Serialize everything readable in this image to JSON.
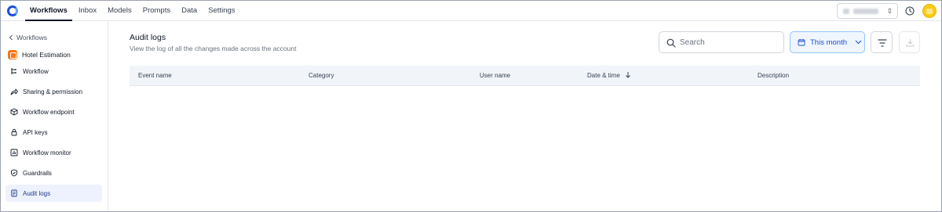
{
  "nav": {
    "tabs": [
      {
        "label": "Workflows",
        "active": true
      },
      {
        "label": "Inbox"
      },
      {
        "label": "Models"
      },
      {
        "label": "Prompts"
      },
      {
        "label": "Data"
      },
      {
        "label": "Settings"
      }
    ]
  },
  "sidebar": {
    "back_label": "Workflows",
    "project_name": "Hotel Estimation",
    "items": [
      {
        "label": "Workflow",
        "icon": "workflow-icon"
      },
      {
        "label": "Sharing & permission",
        "icon": "share-icon"
      },
      {
        "label": "Workflow endpoint",
        "icon": "cube-icon"
      },
      {
        "label": "API keys",
        "icon": "lock-icon"
      },
      {
        "label": "Workflow monitor",
        "icon": "monitor-chart-icon"
      },
      {
        "label": "Guardrails",
        "icon": "shield-icon"
      },
      {
        "label": "Audit logs",
        "icon": "document-icon",
        "active": true
      }
    ]
  },
  "page": {
    "title": "Audit logs",
    "subtitle": "View the log of all the changes made across the account"
  },
  "search": {
    "placeholder": "Search"
  },
  "date_filter": {
    "label": "This month"
  },
  "table": {
    "columns": [
      "Event name",
      "Category",
      "User name",
      "Date & time",
      "Description"
    ],
    "sorted_column": "Date & time",
    "sort_direction": "descending"
  },
  "colors": {
    "accent": "#1d4ed8",
    "active_bg": "#eef2ff",
    "table_header_bg": "#f1f5f9"
  }
}
